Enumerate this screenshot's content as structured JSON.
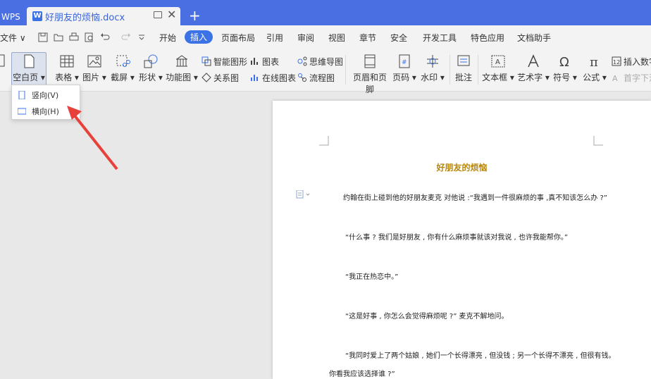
{
  "titlebar": {
    "app_tab": "WPS",
    "doc_tab": "好朋友的烦恼.docx",
    "doc_icon": "W",
    "new_tab": "+",
    "close": "✕"
  },
  "menubar": {
    "file": "文件 ∨",
    "tabs": [
      "开始",
      "插入",
      "页面布局",
      "引用",
      "审阅",
      "视图",
      "章节",
      "安全",
      "开发工具",
      "特色应用",
      "文档助手"
    ],
    "active_tab": "插入"
  },
  "ribbon": {
    "blank_page": "空白页",
    "table": "表格",
    "picture": "图片",
    "screenshot": "截屏",
    "shape": "形状",
    "function_chart": "功能图",
    "smart_shape": "智能图形",
    "chart": "图表",
    "mind_map": "思维导图",
    "relation": "关系图",
    "online_chart": "在线图表",
    "flowchart": "流程图",
    "header_footer": "页眉和页脚",
    "page_number": "页码",
    "watermark": "水印",
    "comment": "批注",
    "textbox": "文本框",
    "wordart": "艺术字",
    "symbol": "符号",
    "formula": "公式",
    "insert_number": "插入数字",
    "drop_cap": "首字下沉"
  },
  "dropdown": {
    "portrait": "竖向(V)",
    "landscape": "横向(H)"
  },
  "document": {
    "title": "好朋友的烦恼",
    "paragraphs": [
      "约翰在街上碰到他的好朋友麦克 对他说 :“我遇到一件很麻烦的事 ,真不知该怎么办 ?”",
      "“什么事 ? 我们是好朋友 , 你有什么麻烦事就该对我说 , 也许我能帮你。”",
      "“我正在热恋中。”",
      "“这是好事 , 你怎么会觉得麻烦呢 ?” 麦克不解地问。",
      "“我同时爱上了两个姑娘 , 她们一个长得漂亮 , 但没钱 ; 另一个长得不漂亮 , 但很有钱。",
      "你看我应该选择谁 ?”"
    ]
  },
  "colors": {
    "titlebar": "#4a6fe3",
    "accent": "#3b73e6",
    "heading": "#b8860b",
    "arrow": "#e8413c"
  }
}
